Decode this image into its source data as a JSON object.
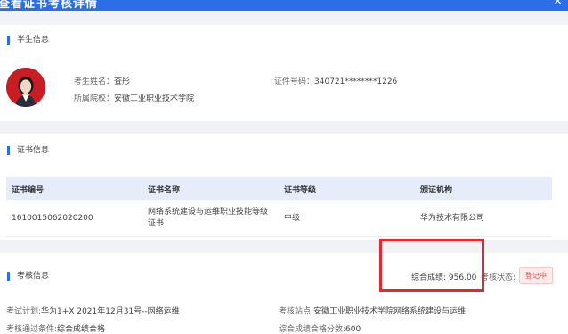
{
  "window": {
    "title": "查看证书考核详情",
    "close_label": "×"
  },
  "student": {
    "section_title": "学生信息",
    "name_label": "考生姓名：",
    "name_value": "查彤",
    "id_label": "证件号码：",
    "id_value": "340721********1226",
    "school_label": "所属院校：",
    "school_value": "安徽工业职业技术学院"
  },
  "certificate": {
    "section_title": "证书信息",
    "columns": [
      "证书编号",
      "证书名称",
      "证书等级",
      "颁证机构"
    ],
    "rows": [
      [
        "1610015062020200",
        "网络系统建设与运维职业技能等级证书",
        "中级",
        "华为技术有限公司"
      ]
    ]
  },
  "exam": {
    "section_title": "考核信息",
    "score_label": "综合成绩:",
    "score_value": "956.00",
    "status_label": "考核状态:",
    "status_value": "登记中",
    "plan_label": "考试计划:",
    "plan_value": "华为1+X 2021年12月31号--网络运维",
    "site_label": "考核站点:",
    "site_value": "安徽工业职业技术学院网络系统建设与运维",
    "pass_label": "考核通过条件:",
    "pass_value": "综合成绩合格",
    "pass_score_label": "综合成绩合格分数:",
    "pass_score_value": "600"
  },
  "colors": {
    "accent": "#2c6ee8",
    "status_red": "#e04848",
    "annotation_red": "#e8262d"
  }
}
